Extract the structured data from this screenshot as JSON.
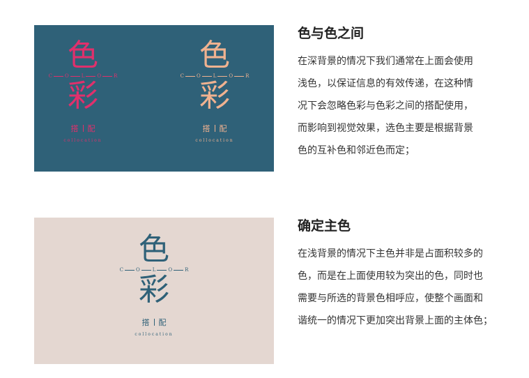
{
  "sections": [
    {
      "title": "色与色之间",
      "lines": [
        "在深背景的情况下我们通常在上面会使用",
        "浅色，以保证信息的有效传递，在这种情",
        "况下会忽略色彩与色彩之间的搭配使用，",
        "而影响到视觉效果，选色主要是根据背景",
        "色的互补色和邻近色而定；"
      ],
      "card_color": "#2f6178",
      "marks": [
        {
          "char1": "色",
          "char2": "彩",
          "letters": [
            "C",
            "O",
            "L",
            "O",
            "R"
          ],
          "sub1": "搭",
          "sub2": "配",
          "tiny": "collocation",
          "color": "#e0306c"
        },
        {
          "char1": "色",
          "char2": "彩",
          "letters": [
            "C",
            "O",
            "L",
            "O",
            "R"
          ],
          "sub1": "搭",
          "sub2": "配",
          "tiny": "collocation",
          "color": "#f0b290"
        }
      ]
    },
    {
      "title": "确定主色",
      "lines": [
        "在浅背景的情况下主色并非是占面积较多的",
        "色，而是在上面使用较为突出的色，同时也",
        "需要与所选的背景色相呼应，使整个画面和",
        "谐统一的情况下更加突出背景上面的主体色；"
      ],
      "card_color": "#e4d7d1",
      "marks": [
        {
          "char1": "色",
          "char2": "彩",
          "letters": [
            "C",
            "O",
            "L",
            "O",
            "R"
          ],
          "sub1": "搭",
          "sub2": "配",
          "tiny": "collocation",
          "color": "#2f6178"
        }
      ]
    }
  ]
}
